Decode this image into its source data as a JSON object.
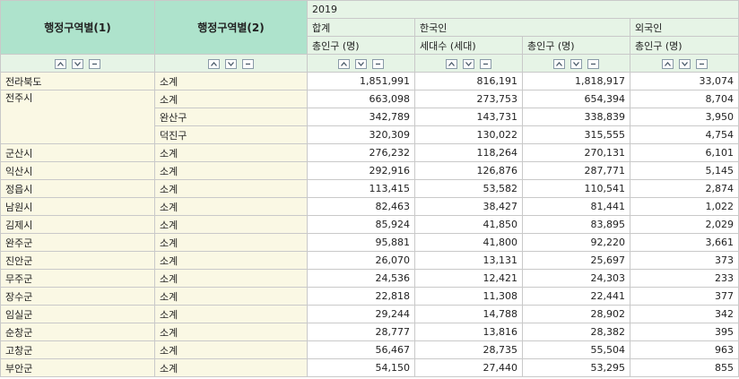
{
  "header": {
    "dim1": "행정구역별(1)",
    "dim2": "행정구역별(2)",
    "year": "2019",
    "groups": [
      "합계",
      "한국인",
      "외국인"
    ],
    "columns": [
      "총인구 (명)",
      "세대수 (세대)",
      "총인구 (명)",
      "총인구 (명)"
    ]
  },
  "controls": {
    "icons": [
      "sort-up-icon",
      "sort-down-icon",
      "collapse-icon"
    ]
  },
  "rows": [
    {
      "r1": "전라북도",
      "r2": "소계",
      "values": [
        "1,851,991",
        "816,191",
        "1,818,917",
        "33,074"
      ]
    },
    {
      "r1": "전주시",
      "r2": "소계",
      "values": [
        "663,098",
        "273,753",
        "654,394",
        "8,704"
      ]
    },
    {
      "r1": "",
      "r2": "완산구",
      "values": [
        "342,789",
        "143,731",
        "338,839",
        "3,950"
      ]
    },
    {
      "r1": "",
      "r2": "덕진구",
      "values": [
        "320,309",
        "130,022",
        "315,555",
        "4,754"
      ]
    },
    {
      "r1": "군산시",
      "r2": "소계",
      "values": [
        "276,232",
        "118,264",
        "270,131",
        "6,101"
      ]
    },
    {
      "r1": "익산시",
      "r2": "소계",
      "values": [
        "292,916",
        "126,876",
        "287,771",
        "5,145"
      ]
    },
    {
      "r1": "정읍시",
      "r2": "소계",
      "values": [
        "113,415",
        "53,582",
        "110,541",
        "2,874"
      ]
    },
    {
      "r1": "남원시",
      "r2": "소계",
      "values": [
        "82,463",
        "38,427",
        "81,441",
        "1,022"
      ]
    },
    {
      "r1": "김제시",
      "r2": "소계",
      "values": [
        "85,924",
        "41,850",
        "83,895",
        "2,029"
      ]
    },
    {
      "r1": "완주군",
      "r2": "소계",
      "values": [
        "95,881",
        "41,800",
        "92,220",
        "3,661"
      ]
    },
    {
      "r1": "진안군",
      "r2": "소계",
      "values": [
        "26,070",
        "13,131",
        "25,697",
        "373"
      ]
    },
    {
      "r1": "무주군",
      "r2": "소계",
      "values": [
        "24,536",
        "12,421",
        "24,303",
        "233"
      ]
    },
    {
      "r1": "장수군",
      "r2": "소계",
      "values": [
        "22,818",
        "11,308",
        "22,441",
        "377"
      ]
    },
    {
      "r1": "임실군",
      "r2": "소계",
      "values": [
        "29,244",
        "14,788",
        "28,902",
        "342"
      ]
    },
    {
      "r1": "순창군",
      "r2": "소계",
      "values": [
        "28,777",
        "13,816",
        "28,382",
        "395"
      ]
    },
    {
      "r1": "고창군",
      "r2": "소계",
      "values": [
        "56,467",
        "28,735",
        "55,504",
        "963"
      ]
    },
    {
      "r1": "부안군",
      "r2": "소계",
      "values": [
        "54,150",
        "27,440",
        "53,295",
        "855"
      ]
    }
  ]
}
